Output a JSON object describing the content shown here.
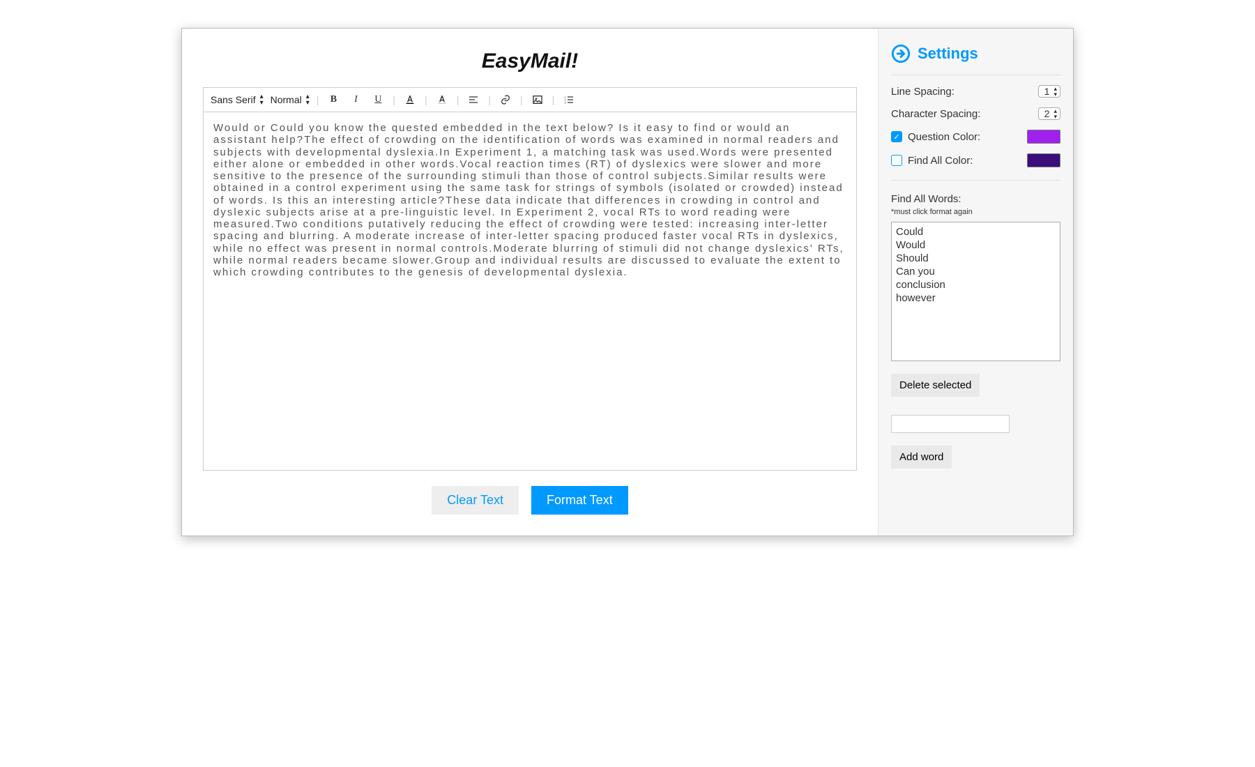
{
  "app": {
    "title": "EasyMail!"
  },
  "toolbar": {
    "font_label": "Sans Serif",
    "size_label": "Normal"
  },
  "editor": {
    "body": "Would or Could you know the quested embedded in the text below? Is it easy to find or would an assistant help?The effect of crowding on the identification of words was examined in normal readers and subjects with developmental dyslexia.In Experiment 1, a matching task was used.Words were presented either alone or embedded in other words.Vocal reaction times (RT) of dyslexics were slower and more sensitive to the presence of the surrounding stimuli than those of control subjects.Similar results were obtained in a control experiment using the same task for strings of symbols (isolated or crowded) instead of words. Is this an interesting article?These data indicate that differences in crowding in control and dyslexic subjects arise at a pre-linguistic level. In Experiment 2, vocal RTs to word reading were measured.Two conditions putatively reducing the effect of crowding were tested: increasing inter-letter spacing and blurring. A moderate increase of inter-letter spacing produced faster vocal RTs in dyslexics, while no effect was present in normal controls.Moderate blurring of stimuli did not change dyslexics' RTs, while normal readers became slower.Group and individual results are discussed to evaluate the extent to which crowding contributes to the genesis of developmental dyslexia."
  },
  "buttons": {
    "clear": "Clear Text",
    "format": "Format Text"
  },
  "settings": {
    "title": "Settings",
    "line_spacing_label": "Line Spacing:",
    "line_spacing_value": "1",
    "char_spacing_label": "Character Spacing:",
    "char_spacing_value": "2",
    "question_color_label": "Question Color:",
    "question_color": "#a020f0",
    "find_all_color_label": "Find All Color:",
    "find_all_color": "#3b0e7a",
    "find_all_words_label": "Find All Words:",
    "hint": "*must click format again",
    "words": [
      "Could",
      "Would",
      "Should",
      "Can you",
      "conclusion",
      "however"
    ],
    "delete_label": "Delete selected",
    "add_label": "Add word",
    "add_value": ""
  }
}
